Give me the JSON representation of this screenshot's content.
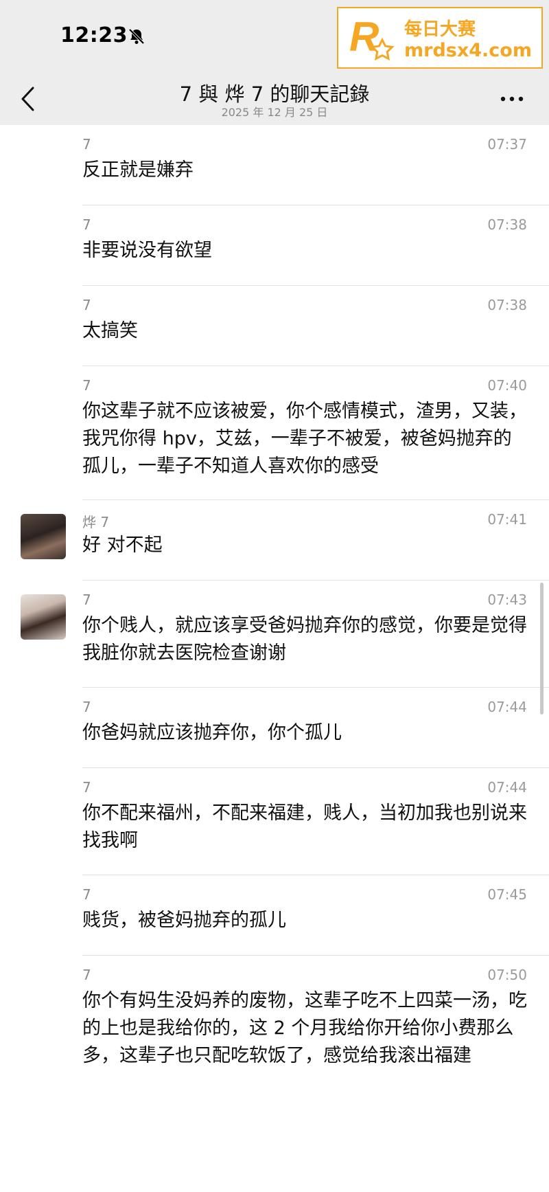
{
  "status_bar": {
    "time": "12:23",
    "mute_icon": "bell-slash-icon"
  },
  "watermark": {
    "brand": "每日大赛",
    "url": "mrdsx4.com",
    "logo_letter": "R",
    "color": "#f5a623"
  },
  "header": {
    "back_icon": "chevron-left-icon",
    "title": "7 與 烨 7 的聊天記錄",
    "date": "2025 年 12 月 25 日",
    "more_icon": "more-horizontal-icon"
  },
  "messages": [
    {
      "sender": "7",
      "time": "07:37",
      "text": "反正就是嫌弃"
    },
    {
      "sender": "7",
      "time": "07:38",
      "text": "非要说没有欲望"
    },
    {
      "sender": "7",
      "time": "07:38",
      "text": "太搞笑"
    },
    {
      "sender": "7",
      "time": "07:40",
      "text": "你这辈子就不应该被爱，你个感情模式，渣男，又装，我咒你得 hpv，艾兹，一辈子不被爱，被爸妈抛弃的孤儿，一辈子不知道人喜欢你的感受"
    },
    {
      "sender": "烨 7",
      "time": "07:41",
      "text": "好 对不起",
      "avatar": "male"
    },
    {
      "sender": "7",
      "time": "07:43",
      "text": "你个贱人，就应该享受爸妈抛弃你的感觉，你要是觉得我脏你就去医院检查谢谢",
      "avatar": "female"
    },
    {
      "sender": "7",
      "time": "07:44",
      "text": "你爸妈就应该抛弃你，你个孤儿"
    },
    {
      "sender": "7",
      "time": "07:44",
      "text": "你不配来福州，不配来福建，贱人，当初加我也别说来找我啊"
    },
    {
      "sender": "7",
      "time": "07:45",
      "text": "贱货，被爸妈抛弃的孤儿"
    },
    {
      "sender": "7",
      "time": "07:50",
      "text": "你个有妈生没妈养的废物，这辈子吃不上四菜一汤，吃的上也是我给你的，这 2 个月我给你开给你小费那么多，这辈子也只配吃软饭了，感觉给我滚出福建"
    }
  ]
}
